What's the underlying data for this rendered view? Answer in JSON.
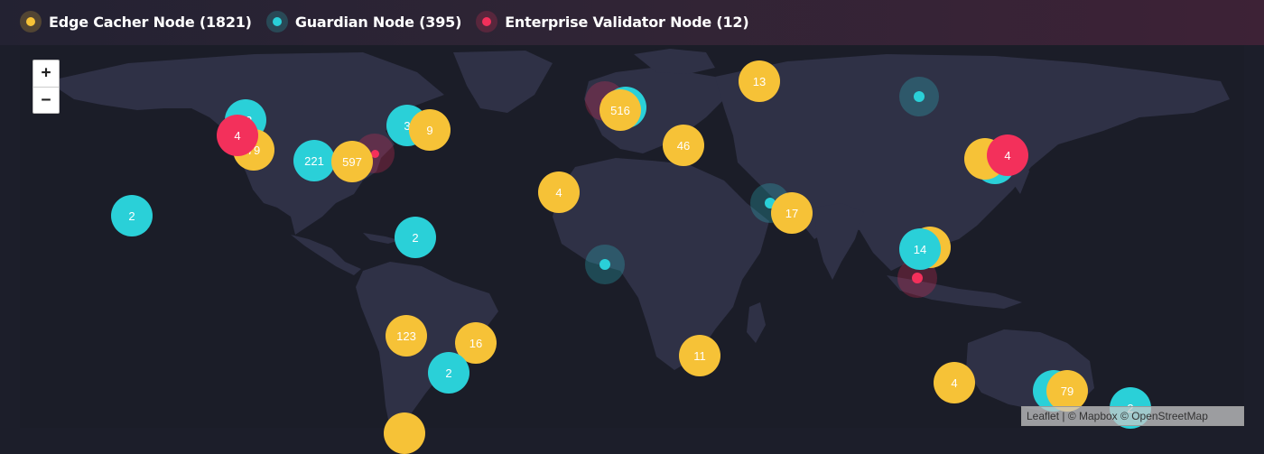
{
  "legend": {
    "items": [
      {
        "label": "Edge Cacher Node (1821)",
        "color": "#f6c237"
      },
      {
        "label": "Guardian Node (395)",
        "color": "#2ad0d8"
      },
      {
        "label": "Enterprise Validator Node (12)",
        "color": "#f3305b"
      }
    ]
  },
  "zoom": {
    "in_label": "+",
    "out_label": "−"
  },
  "attribution": "Leaflet | © Mapbox © OpenStreetMap",
  "clusters": [
    {
      "count": "22",
      "color": "guardian"
    },
    {
      "count": "79",
      "color": "edge"
    },
    {
      "count": "4",
      "color": "validator"
    },
    {
      "count": "221",
      "color": "guardian"
    },
    {
      "count": "597",
      "color": "edge"
    },
    {
      "count": "3",
      "color": "guardian"
    },
    {
      "count": "9",
      "color": "edge"
    },
    {
      "count": "2",
      "color": "guardian"
    },
    {
      "count": "2",
      "color": "guardian"
    },
    {
      "count": "123",
      "color": "edge"
    },
    {
      "count": "16",
      "color": "edge"
    },
    {
      "count": "2",
      "color": "guardian"
    },
    {
      "count": "",
      "color": "edge"
    },
    {
      "count": "",
      "color": "guardian"
    },
    {
      "count": "516",
      "color": "edge"
    },
    {
      "count": "13",
      "color": "edge"
    },
    {
      "count": "46",
      "color": "edge"
    },
    {
      "count": "4",
      "color": "edge"
    },
    {
      "count": "17",
      "color": "edge"
    },
    {
      "count": "11",
      "color": "edge"
    },
    {
      "count": "",
      "color": "guardian"
    },
    {
      "count": "",
      "color": "edge"
    },
    {
      "count": "4",
      "color": "validator"
    },
    {
      "count": "",
      "color": "edge"
    },
    {
      "count": "14",
      "color": "guardian"
    },
    {
      "count": "4",
      "color": "edge"
    },
    {
      "count": "",
      "color": "guardian"
    },
    {
      "count": "79",
      "color": "edge"
    },
    {
      "count": "2",
      "color": "guardian"
    }
  ],
  "markers": [
    {
      "type": "validator"
    },
    {
      "type": "validator"
    },
    {
      "type": "guardian"
    },
    {
      "type": "guardian"
    },
    {
      "type": "guardian"
    },
    {
      "type": "validator"
    }
  ]
}
